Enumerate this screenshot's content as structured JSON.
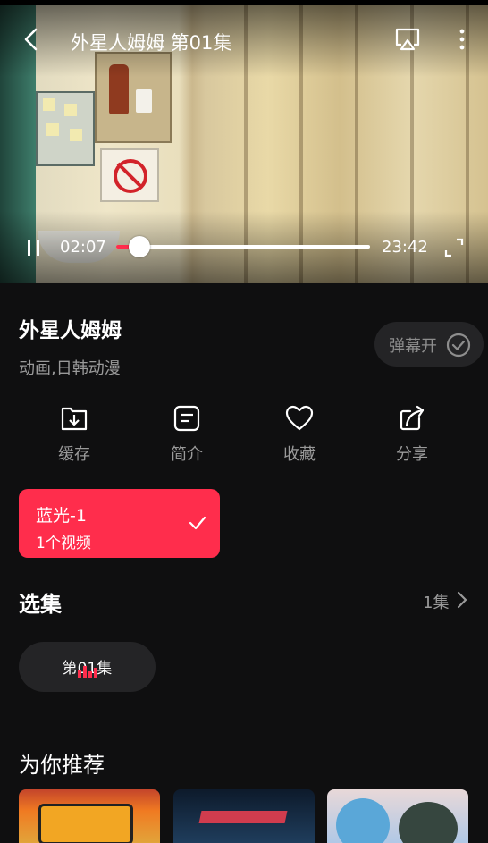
{
  "player": {
    "title": "外星人姆姆 第01集",
    "current_time": "02:07",
    "total_time": "23:42",
    "progress": 0.09
  },
  "show": {
    "title": "外星人姆姆",
    "tags": "动画,日韩动漫",
    "danmaku_label": "弹幕开"
  },
  "actions": [
    {
      "label": "缓存",
      "icon": "download-icon"
    },
    {
      "label": "简介",
      "icon": "intro-icon"
    },
    {
      "label": "收藏",
      "icon": "heart-icon"
    },
    {
      "label": "分享",
      "icon": "share-icon"
    }
  ],
  "source": {
    "name": "蓝光-1",
    "count": "1个视频"
  },
  "episodes": {
    "section_title": "选集",
    "count_label": "1集",
    "items": [
      {
        "label": "第01集",
        "playing": true
      }
    ]
  },
  "recommend": {
    "section_title": "为你推荐"
  },
  "colors": {
    "accent": "#ff2d4c",
    "background": "#0f0f10",
    "chip": "#242426",
    "muted_text": "#9a9a9a"
  }
}
